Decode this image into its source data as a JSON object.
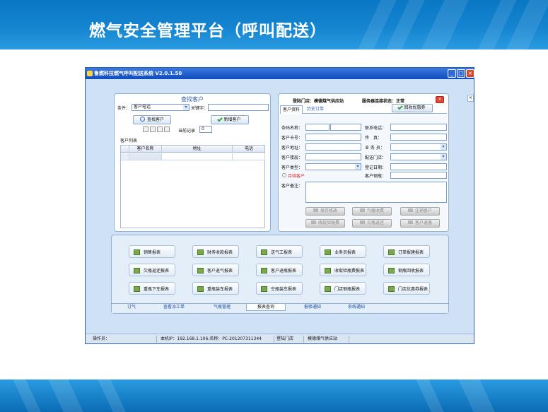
{
  "slide": {
    "title": "燃气安全管理平台（呼叫配送）"
  },
  "window": {
    "title": "鲁燃科技燃气呼叫配送系统 V2.0.1.50",
    "controls": [
      "_",
      "□",
      "×"
    ]
  },
  "find_panel": {
    "title": "查找客户",
    "condition_label": "条件：",
    "condition_value": "客户电话",
    "keyword_label": "关键字：",
    "keyword_value": "",
    "search_button": "查找客户",
    "add_button": "新增客户",
    "current_record_label": "当前记录",
    "current_record_value": "0",
    "list_label": "客户列表",
    "columns": [
      "客户名称",
      "地址",
      "电话"
    ]
  },
  "detail_panel": {
    "store_label": "登陆门店：",
    "store_value": "模德煤气供应站",
    "server_label": "服务器连接状态：",
    "server_value": "正常",
    "tabs": [
      "客户资料",
      "历史订单"
    ],
    "coupon_button": "回收优惠券",
    "fields_left": [
      {
        "label": "条码名称：",
        "value": ""
      },
      {
        "label": "客户卡号：",
        "value": ""
      },
      {
        "label": "客户地址：",
        "value": ""
      },
      {
        "label": "客户楼层：",
        "value": ""
      },
      {
        "label": "客户类型：",
        "value": ""
      }
    ],
    "fields_right": [
      {
        "label": "联系电话：",
        "value": ""
      },
      {
        "label": "传　真：",
        "value": ""
      },
      {
        "label": "业 务 员：",
        "value": ""
      },
      {
        "label": "配送门店：",
        "value": ""
      },
      {
        "label": "登记日期：",
        "value": ""
      },
      {
        "label": "客户钢瓶：",
        "value": ""
      }
    ],
    "monthly_label": "月结客户",
    "remark_label": "客户备注：",
    "buttons_row1": [
      "保存修改",
      "气瓶收费",
      "注销客户"
    ],
    "buttons_row2": [
      "收款验账费",
      "欠瓶返还",
      "客户退瓶"
    ]
  },
  "reports": {
    "items": [
      "销售报表",
      "财务收款报表",
      "送气工报表",
      "业务员报表",
      "订单报建报表",
      "欠瓶返还报表",
      "客户退气报表",
      "客户退瓶报表",
      "收取验瓶费报表",
      "钢瓶回收报表",
      "重瓶下车报表",
      "重瓶装车报表",
      "空瓶装车报表",
      "门店钢瓶报表",
      "门店优惠券报表"
    ],
    "nav_tabs": [
      "订气",
      "查看派工单",
      "气瓶管理",
      "报表查询",
      "报修通知",
      "系统通知"
    ],
    "active_tab": "报表查询"
  },
  "statusbar": {
    "operator_label": "操作员：",
    "operator_value": "",
    "machine_info": "本机IP：192.168.1.106,名称：PC-201207311344",
    "store_label": "登陆门店",
    "store_value": "模德煤气供应站"
  },
  "colors": {
    "slide_blue": "#0a77c4",
    "window_bg": "#cfe1f5",
    "title_bar": "#0f4bbd",
    "accent_text": "#2a5aa8"
  }
}
